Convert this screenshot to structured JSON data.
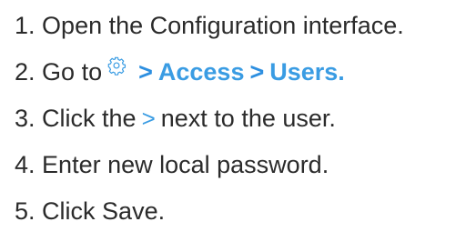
{
  "steps": [
    {
      "number": "1.",
      "text": "Open the Configuration interface."
    },
    {
      "number": "2.",
      "prefix": "Go to",
      "icon": "gear-icon",
      "path": [
        ">",
        "Access",
        ">",
        "Users."
      ]
    },
    {
      "number": "3.",
      "prefix": "Click the",
      "inline_symbol": ">",
      "suffix": "next to the user."
    },
    {
      "number": "4.",
      "text": "Enter new local password."
    },
    {
      "number": "5.",
      "text": "Click Save."
    }
  ],
  "colors": {
    "text": "#2b2b2b",
    "accent": "#3a9ce3"
  }
}
